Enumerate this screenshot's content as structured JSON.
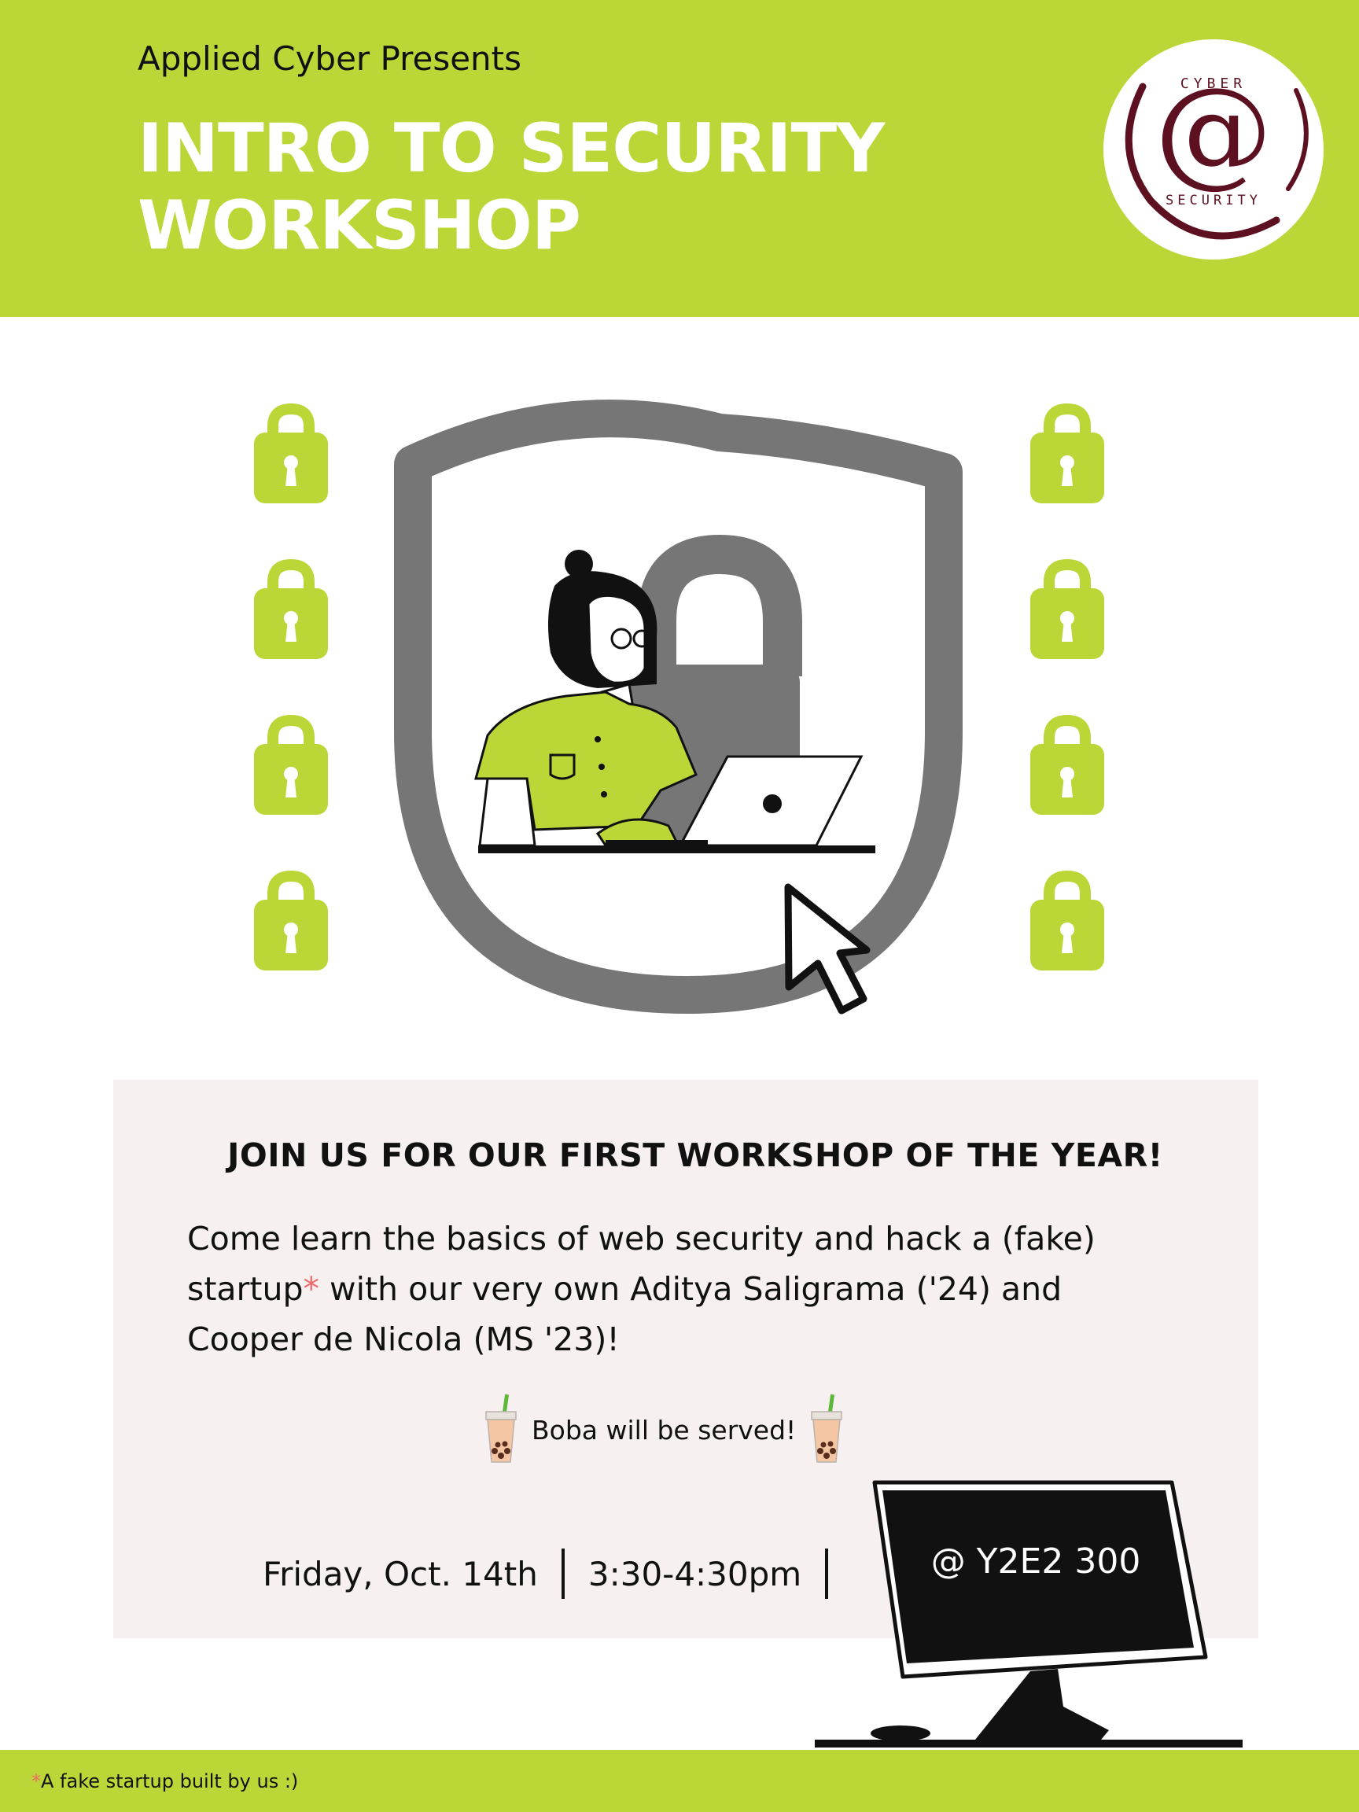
{
  "header": {
    "presents": "Applied Cyber Presents",
    "title": "INTRO TO SECURITY WORKSHOP",
    "logo": {
      "icon": "at-sign-logo",
      "top_text": "CYBER",
      "bottom_text": "SECURITY"
    }
  },
  "hero": {
    "illustration": "woman-at-laptop-in-shield",
    "icons": [
      "padlock-icon",
      "shield-icon",
      "cursor-arrow-icon",
      "laptop-icon"
    ]
  },
  "info": {
    "headline": "JOIN US FOR OUR FIRST WORKSHOP OF THE YEAR!",
    "body_part1": "Come learn the basics of web security and hack a (fake) startup",
    "body_asterisk": "*",
    "body_part2": " with our very own Aditya Saligrama ('24) and Cooper de Nicola (MS '23)!",
    "boba": "Boba will be served!",
    "date": "Friday, Oct. 14th",
    "time": "3:30-4:30pm",
    "location": "@ Y2E2 300"
  },
  "footer": {
    "asterisk": "*",
    "note": "A fake startup built by us :)"
  },
  "colors": {
    "accent": "#bbd737",
    "shield_gray": "#767676",
    "logo_maroon": "#5c1020",
    "panel_bg": "#f6f0f0",
    "asterisk": "#f06a6a"
  }
}
